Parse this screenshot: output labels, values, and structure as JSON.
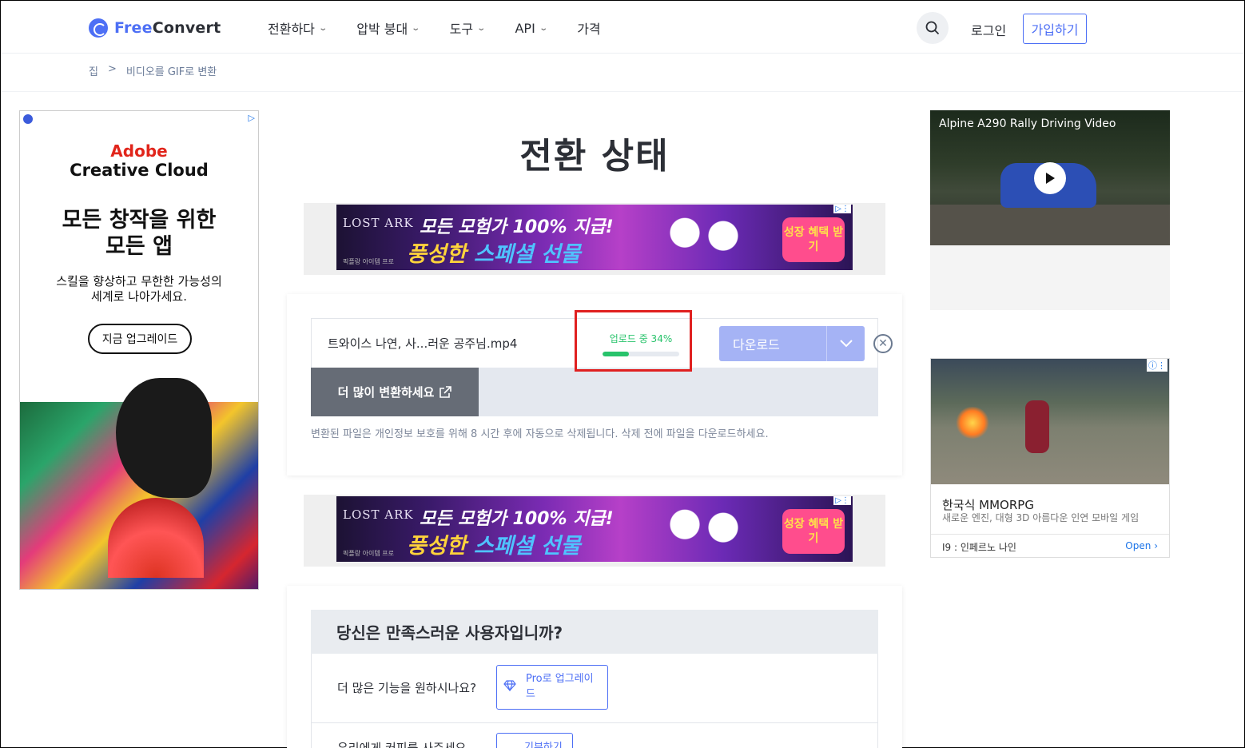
{
  "header": {
    "logo_free": "Free",
    "logo_convert": "Convert",
    "nav": [
      {
        "label": "전환하다"
      },
      {
        "label": "압박 붕대"
      },
      {
        "label": "도구"
      },
      {
        "label": "API"
      },
      {
        "label": "가격"
      }
    ],
    "login": "로그인",
    "signup": "가입하기"
  },
  "breadcrumb": {
    "home": "집",
    "separator": ">",
    "current": "비디오를 GIF로 변환"
  },
  "left_ad": {
    "brand_line1": "Adobe",
    "brand_line2": "Creative Cloud",
    "headline_line1": "모든 창작을 위한",
    "headline_line2": "모든 앱",
    "sub_line1": "스킬을 향상하고 무한한 가능성의",
    "sub_line2": "세계로 나아가세요.",
    "cta": "지금 업그레이드"
  },
  "main": {
    "title": "전환 상태",
    "banner": {
      "brand": "LOST ARK",
      "brand_small": "픽플랑 아이템 프로",
      "line1": "모든 모험가 100% 지급!",
      "line2_a": "풍성한 ",
      "line2_b": "스페셜 선물",
      "badge": "성장 혜택 받기"
    },
    "file": {
      "name": "트와이스 나연, 사...러운 공주님.mp4",
      "upload_label": "업로드 중 34%",
      "progress_percent": 34,
      "download_label": "다운로드",
      "more_label": "더 많이 변환하세요",
      "notice": "변환된 파일은 개인정보 보호를 위해 8 시간 후에 자동으로 삭제됩니다. 삭제 전에 파일을 다운로드하세요."
    },
    "satisfaction": {
      "heading": "당신은 만족스러운 사용자입니까?",
      "q1": "더 많은 기능을 원하시나요?",
      "pro_line1": "Pro로 업그레이",
      "pro_line2": "드",
      "q2": "우리에게 커피를 사주세요",
      "donate": "기부하기"
    }
  },
  "right_ads": {
    "video_title": "Alpine A290 Rally Driving Video",
    "game_title": "한국식 MMORPG",
    "game_desc": "새로운 엔진, 대형 3D 아름다운 인연 모바일 게임",
    "game_advertiser": "I9 : 인페르노 나인",
    "game_open": "Open"
  },
  "colors": {
    "brand": "#4d6ff5",
    "success": "#28c36b",
    "highlight": "#e02020"
  }
}
